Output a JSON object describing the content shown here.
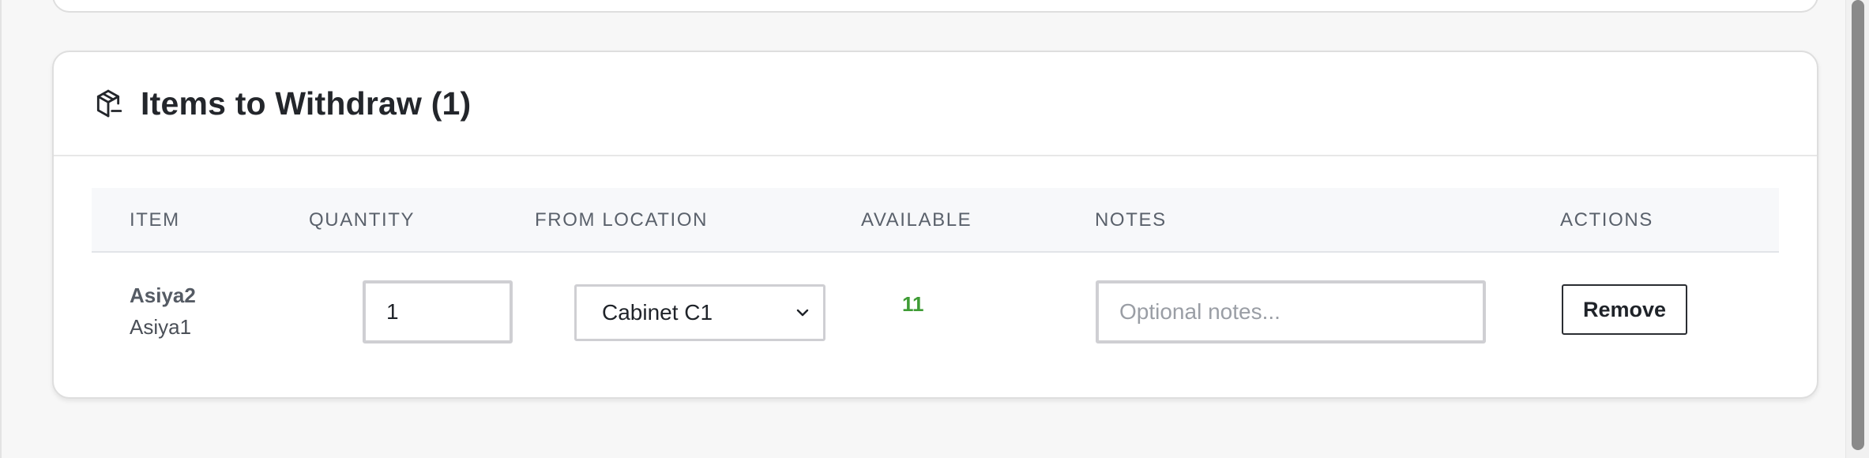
{
  "card": {
    "title": "Items to Withdraw (1)",
    "icon": "package-icon"
  },
  "table": {
    "columns": {
      "item": "ITEM",
      "quantity": "QUANTITY",
      "from_location": "FROM LOCATION",
      "available": "AVAILABLE",
      "notes": "NOTES",
      "actions": "ACTIONS"
    },
    "rows": [
      {
        "item_line1": "Asiya2",
        "item_line2": "Asiya1",
        "quantity": "1",
        "from_location": "Cabinet C1",
        "available": "11",
        "notes_value": "",
        "notes_placeholder": "Optional notes...",
        "remove_label": "Remove"
      }
    ]
  },
  "colors": {
    "available": "#3f9c35",
    "border": "#dedede",
    "header_bg": "#f7f8fa"
  }
}
